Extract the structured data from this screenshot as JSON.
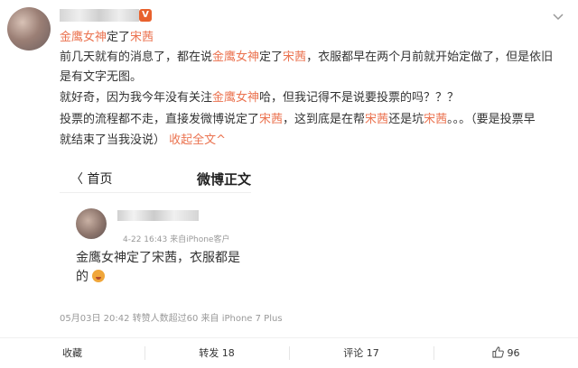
{
  "post": {
    "mention": "金鹰女神",
    "mention_suffix": "定了",
    "mention_name": "宋茜",
    "vip_badge": "V",
    "body_line1": {
      "a": "前几天就有的消息了，都在说",
      "hl1": "金鹰女神",
      "b": "定了",
      "hl2": "宋茜",
      "c": "，衣服都早在两个月前就开始定做了，但是依旧"
    },
    "body_line2": "是有文字无图。",
    "body_line3": {
      "a": "就好奇，因为我今年没有关注",
      "hl": "金鹰女神",
      "b": "哈，但我记得不是说要投票的吗？？？"
    },
    "body_line4": {
      "a": "投票的流程都不走，直接发微博说定了",
      "hl1": "宋茜",
      "b": "，这到底是在帮",
      "hl2": "宋茜",
      "c": "还是坑",
      "hl3": "宋茜",
      "d": "。。。（要是投票早"
    },
    "body_line5": {
      "a": "就结束了当我没说）",
      "link": "收起全文",
      "link_icon": "^"
    }
  },
  "embed": {
    "back_label": "〈 首页",
    "title": "微博正文",
    "meta": "4-22 16:43  来自iPhone客户",
    "text_line1": "金鹰女神定了宋茜，衣服都是",
    "text_line2": "的",
    "emoji_icon": "blushing-face-icon"
  },
  "footer_meta": "05月03日 20:42 转赞人数超过60 来自 iPhone 7 Plus",
  "actions": {
    "favorite": "收藏",
    "repost": "转发 18",
    "comment": "评论 17",
    "like_count": "96"
  },
  "colors": {
    "accent": "#eb7350",
    "meta_gray": "#999999"
  }
}
